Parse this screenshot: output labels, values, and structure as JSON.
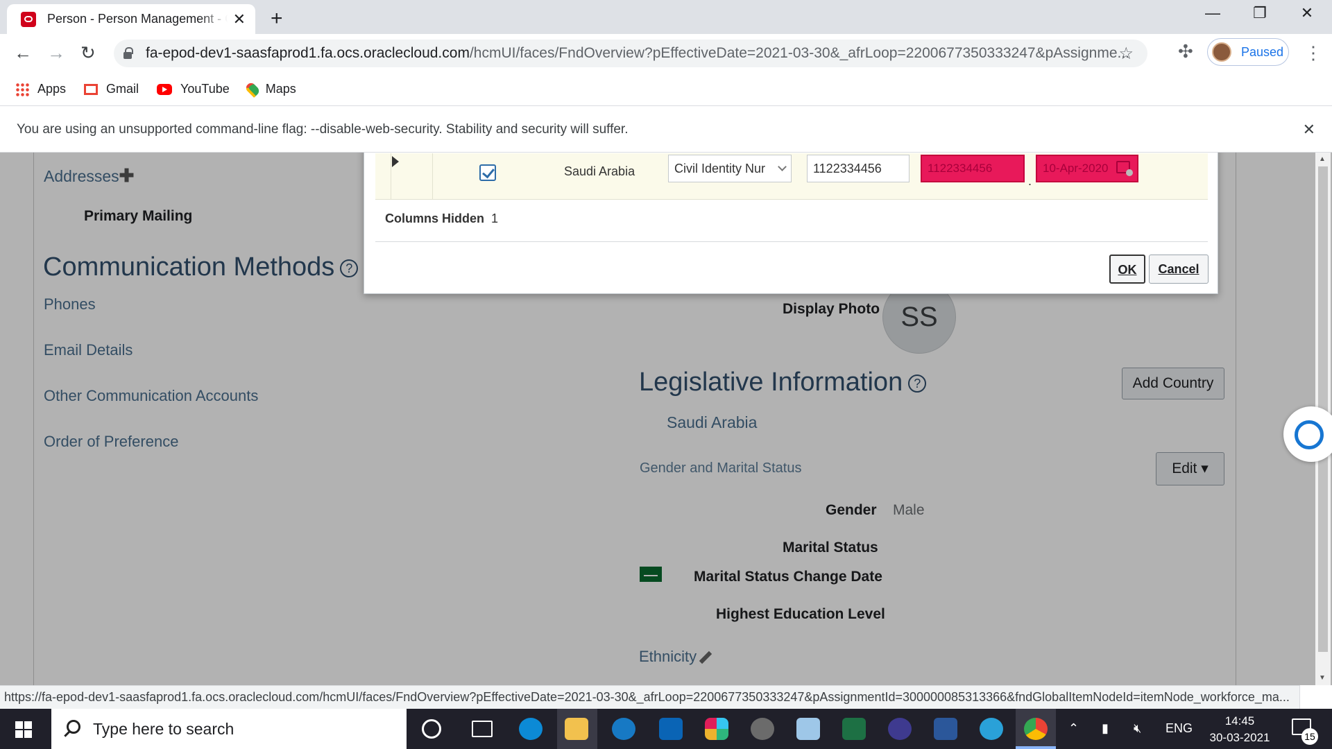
{
  "browser": {
    "tab_title": "Person - Person Management - C",
    "tab_close": "✕",
    "new_tab": "+",
    "url_host": "fa-epod-dev1-saasfaprod1.fa.ocs.oraclecloud.com",
    "url_path": "/hcmUI/faces/FndOverview?pEffectiveDate=2021-03-30&_afrLoop=2200677350333247&pAssignme...",
    "profile_label": "Paused",
    "bookmarks": [
      "Apps",
      "Gmail",
      "YouTube",
      "Maps"
    ],
    "infobar_text": "You are using an unsupported command-line flag: --disable-web-security. Stability and security will suffer.",
    "status_url": "https://fa-epod-dev1-saasfaprod1.fa.ocs.oraclecloud.com/hcmUI/faces/FndOverview?pEffectiveDate=2021-03-30&_afrLoop=2200677350333247&pAssignmentId=300000085313366&fndGlobalItemNodeId=itemNode_workforce_ma..."
  },
  "page": {
    "addresses_label": "Addresses",
    "primary_mailing": "Primary Mailing",
    "communication_methods": "Communication Methods",
    "phones": "Phones",
    "email_details": "Email Details",
    "other_accounts": "Other Communication Accounts",
    "order_of_preference": "Order of Preference",
    "display_photo": "Display Photo",
    "photo_initials": "SS",
    "legislative_information": "Legislative Information",
    "add_country": "Add Country",
    "country": "Saudi Arabia",
    "gender_marital_status": "Gender and Marital Status",
    "edit_label": "Edit",
    "gender_label": "Gender",
    "gender_value": "Male",
    "marital_status": "Marital Status",
    "marital_status_change_date": "Marital Status Change Date",
    "highest_education_level": "Highest Education Level",
    "ethnicity": "Ethnicity"
  },
  "dialog": {
    "row": {
      "country": "Saudi Arabia",
      "id_type": "Civil Identity Nur",
      "id_number": "1122334456",
      "error_number": "1122334456",
      "error_date": "10-Apr-2020",
      "checked": true
    },
    "columns_hidden_label": "Columns Hidden",
    "columns_hidden_count": "1",
    "ok_label": "OK",
    "cancel_label": "Cancel"
  },
  "taskbar": {
    "search_placeholder": "Type here to search",
    "language": "ENG",
    "time": "14:45",
    "date": "30-03-2021",
    "notification_count": "15"
  },
  "colors": {
    "error_fill": "#e8195a",
    "heading_blue": "#31506e",
    "label_blue": "#4a6f8f"
  }
}
